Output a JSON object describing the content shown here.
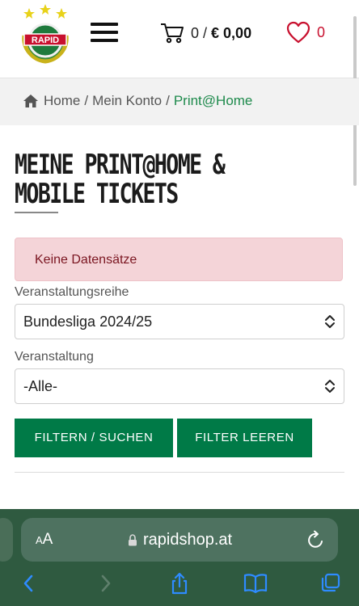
{
  "header": {
    "logo_text": "RAPID",
    "cart": {
      "count": "0",
      "separator": "/",
      "total": "€ 0,00"
    },
    "wishlist": {
      "count": "0"
    }
  },
  "breadcrumb": {
    "home": "Home",
    "separator": "/",
    "account": "Mein Konto",
    "current": "Print@Home"
  },
  "page": {
    "title": "Meine Print@Home & Mobile Tickets"
  },
  "alert": {
    "text": "Keine Datensätze"
  },
  "filters": {
    "series_label": "Veranstaltungsreihe",
    "series_value": "Bundesliga 2024/25",
    "event_label": "Veranstaltung",
    "event_value": "-Alle-",
    "submit_label": "FILTERN / SUCHEN",
    "clear_label": "FILTER LEEREN"
  },
  "browser": {
    "text_size_small": "A",
    "text_size_large": "A",
    "url": "rapidshop.at"
  },
  "colors": {
    "brand_green": "#007a47",
    "link_green": "#1e8a4c",
    "alert_bg": "#f4d4d8",
    "wish_red": "#c8102e",
    "browser_bg": "#2f5a40"
  },
  "icons": [
    "rapid-logo",
    "hamburger-menu-icon",
    "cart-icon",
    "heart-icon",
    "home-icon",
    "chevron-updown-icon",
    "lock-icon",
    "reload-icon",
    "back-icon",
    "forward-icon",
    "share-icon",
    "bookmarks-icon",
    "tabs-icon"
  ]
}
